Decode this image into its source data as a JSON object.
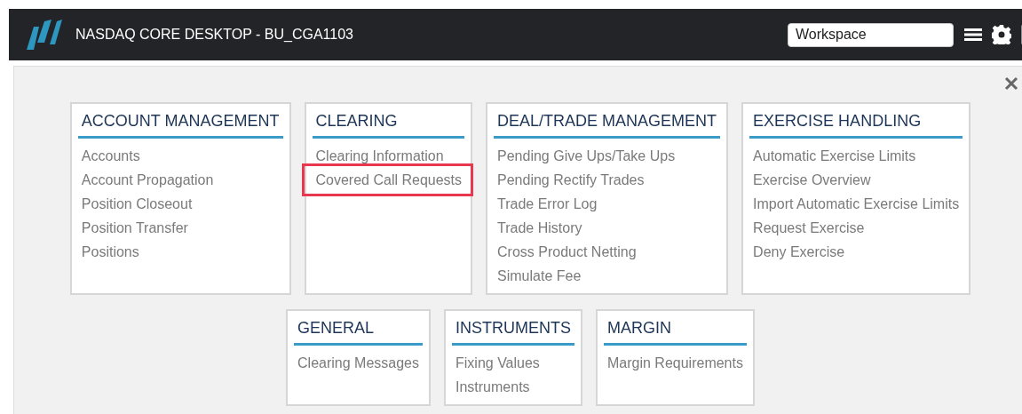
{
  "header": {
    "title": "NASDAQ CORE DESKTOP - BU_CGA1103",
    "workspace": {
      "value": "Workspace"
    }
  },
  "rows": [
    {
      "cards": [
        {
          "title": "ACCOUNT MANAGEMENT",
          "items": [
            {
              "label": "Accounts",
              "highlighted": false
            },
            {
              "label": "Account Propagation",
              "highlighted": false
            },
            {
              "label": "Position Closeout",
              "highlighted": false
            },
            {
              "label": "Position Transfer",
              "highlighted": false
            },
            {
              "label": "Positions",
              "highlighted": false
            }
          ]
        },
        {
          "title": "CLEARING",
          "items": [
            {
              "label": "Clearing Information",
              "highlighted": false
            },
            {
              "label": "Covered Call Requests",
              "highlighted": true
            }
          ]
        },
        {
          "title": "DEAL/TRADE MANAGEMENT",
          "items": [
            {
              "label": "Pending Give Ups/Take Ups",
              "highlighted": false
            },
            {
              "label": "Pending Rectify Trades",
              "highlighted": false
            },
            {
              "label": "Trade Error Log",
              "highlighted": false
            },
            {
              "label": "Trade History",
              "highlighted": false
            },
            {
              "label": "Cross Product Netting",
              "highlighted": false
            },
            {
              "label": "Simulate Fee",
              "highlighted": false
            }
          ]
        },
        {
          "title": "EXERCISE HANDLING",
          "items": [
            {
              "label": "Automatic Exercise Limits",
              "highlighted": false
            },
            {
              "label": "Exercise Overview",
              "highlighted": false
            },
            {
              "label": "Import Automatic Exercise Limits",
              "highlighted": false
            },
            {
              "label": "Request Exercise",
              "highlighted": false
            },
            {
              "label": "Deny Exercise",
              "highlighted": false
            }
          ]
        }
      ]
    },
    {
      "cards": [
        {
          "title": "GENERAL",
          "items": [
            {
              "label": "Clearing Messages",
              "highlighted": false
            }
          ]
        },
        {
          "title": "INSTRUMENTS",
          "items": [
            {
              "label": "Fixing Values",
              "highlighted": false
            },
            {
              "label": "Instruments",
              "highlighted": false
            }
          ]
        },
        {
          "title": "MARGIN",
          "items": [
            {
              "label": "Margin Requirements",
              "highlighted": false
            }
          ]
        }
      ]
    }
  ]
}
